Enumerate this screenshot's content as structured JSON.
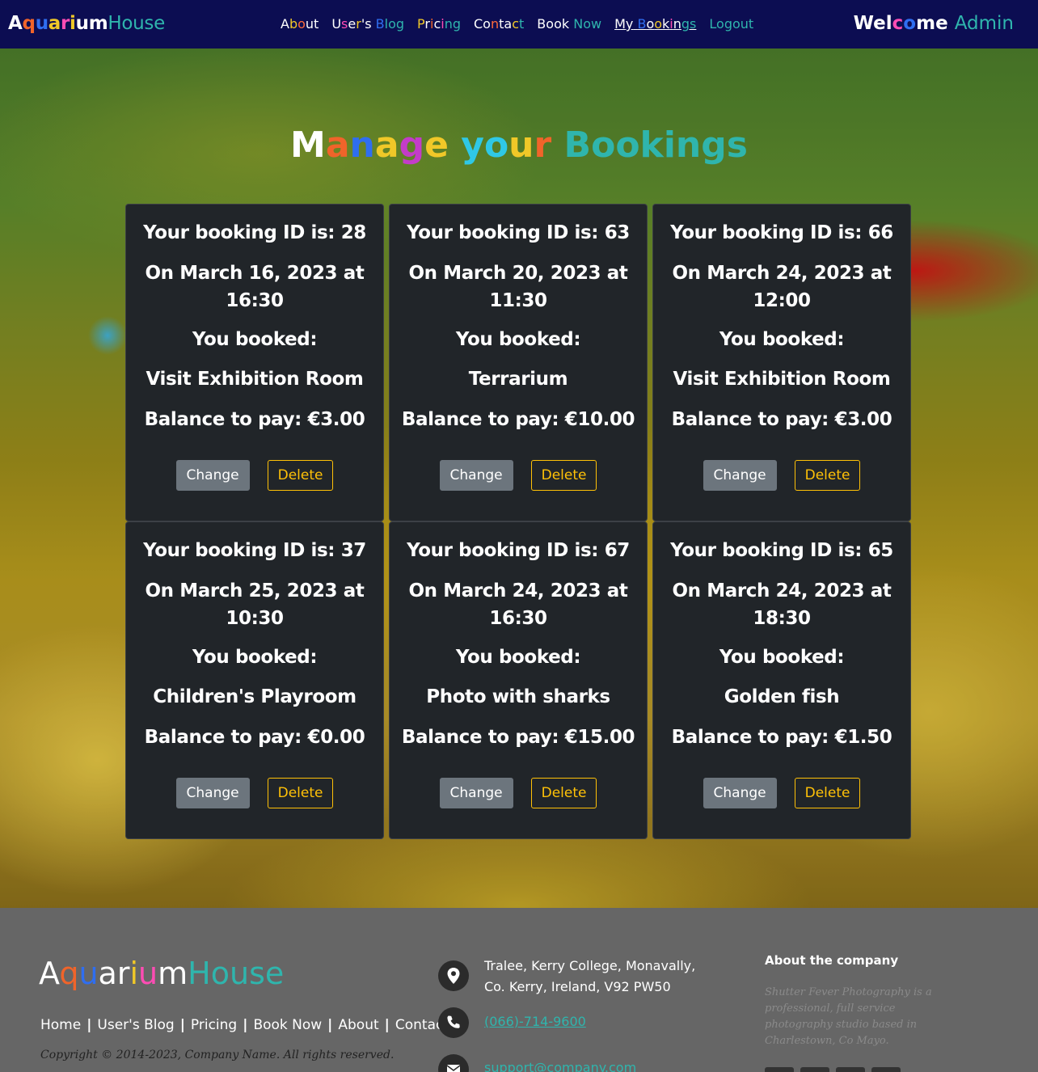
{
  "navbar": {
    "brand": {
      "letters": [
        {
          "ch": "A",
          "color": "#ffffff"
        },
        {
          "ch": "q",
          "color": "#f0642a"
        },
        {
          "ch": "u",
          "color": "#2f6ef0"
        },
        {
          "ch": "a",
          "color": "#f0c828"
        },
        {
          "ch": "r",
          "color": "#ff4cb4"
        },
        {
          "ch": "i",
          "color": "#f0c828"
        },
        {
          "ch": "u",
          "color": "#ffffff"
        },
        {
          "ch": "m",
          "color": "#ffffff"
        }
      ],
      "suffix": "House"
    },
    "links": [
      {
        "label": "About",
        "colors": [
          "#ffffff",
          "#f0c828",
          "#ff6a3a",
          "#ffffff",
          "#ffffff"
        ]
      },
      {
        "label": "User's Blog",
        "colors": [
          "#ffffff",
          "#ff4cb4",
          "#ffffff",
          "#f0c828",
          "#ffffff",
          "#ffffff",
          "#ffffff",
          "#2f6ef0",
          "#2fb5ad",
          "#2fb5ad",
          "#2fb5ad"
        ]
      },
      {
        "label": "Pricing",
        "colors": [
          "#f0c828",
          "#ffffff",
          "#f0642a",
          "#ffffff",
          "#ff4cb4",
          "#2fb5ad",
          "#2fb5ad"
        ]
      },
      {
        "label": "Contact",
        "colors": [
          "#ffffff",
          "#ffffff",
          "#ff6a3a",
          "#ffffff",
          "#ffffff",
          "#f0c828",
          "#2fb5ad"
        ]
      },
      {
        "label": "Book Now",
        "colors": [
          "#ffffff",
          "#ffffff",
          "#ffffff",
          "#ffffff",
          "#ffffff",
          "#2fb5ad",
          "#2fb5ad",
          "#2fb5ad"
        ]
      },
      {
        "label": "My Bookings",
        "colors": [
          "#ffffff",
          "#ffffff",
          "#ffffff",
          "#2f6ef0",
          "#ffffff",
          "#f0c828",
          "#ffffff",
          "#ff4cb4",
          "#ffffff",
          "#2fb5ad",
          "#2fb5ad"
        ],
        "active": true
      },
      {
        "label": "Logout",
        "colors": [
          "#2fb5ad",
          "#2fb5ad",
          "#2fb5ad",
          "#2fb5ad",
          "#2fb5ad",
          "#2fb5ad"
        ]
      }
    ],
    "welcome": {
      "letters": [
        {
          "ch": "W",
          "color": "#ffffff"
        },
        {
          "ch": "e",
          "color": "#ffffff"
        },
        {
          "ch": "l",
          "color": "#ffffff"
        },
        {
          "ch": "c",
          "color": "#ff4cb4"
        },
        {
          "ch": "o",
          "color": "#2f6ef0"
        },
        {
          "ch": "m",
          "color": "#ffffff"
        },
        {
          "ch": "e",
          "color": "#ffffff"
        }
      ],
      "name": "Admin"
    }
  },
  "page_title": {
    "letters": [
      {
        "ch": "M",
        "color": "#ffffff"
      },
      {
        "ch": "a",
        "color": "#f0642a"
      },
      {
        "ch": "n",
        "color": "#2f6ef0"
      },
      {
        "ch": "a",
        "color": "#f0c828"
      },
      {
        "ch": "g",
        "color": "#c33cc8"
      },
      {
        "ch": "e",
        "color": "#f0c828"
      },
      {
        "ch": " ",
        "color": "#ffffff"
      },
      {
        "ch": "y",
        "color": "#2fc8e6"
      },
      {
        "ch": "o",
        "color": "#2fc8e6"
      },
      {
        "ch": "u",
        "color": "#f0c828"
      },
      {
        "ch": "r",
        "color": "#f0642a"
      },
      {
        "ch": " ",
        "color": "#ffffff"
      },
      {
        "ch": "B",
        "color": "#2fb5ad"
      },
      {
        "ch": "o",
        "color": "#2fb5ad"
      },
      {
        "ch": "o",
        "color": "#2fb5ad"
      },
      {
        "ch": "k",
        "color": "#2fb5ad"
      },
      {
        "ch": "i",
        "color": "#2fb5ad"
      },
      {
        "ch": "n",
        "color": "#2fb5ad"
      },
      {
        "ch": "g",
        "color": "#2fb5ad"
      },
      {
        "ch": "s",
        "color": "#2fb5ad"
      }
    ]
  },
  "bookings": [
    {
      "id_line": "Your booking ID is: 28",
      "date_line": "On March 16, 2023 at",
      "time_line": "16:30",
      "booked_label": "You booked:",
      "item": "Visit Exhibition Room",
      "balance": "Balance to pay: €3.00",
      "change_label": "Change",
      "delete_label": "Delete"
    },
    {
      "id_line": "Your booking ID is: 63",
      "date_line": "On March 20, 2023 at",
      "time_line": "11:30",
      "booked_label": "You booked:",
      "item": "Terrarium",
      "balance": "Balance to pay: €10.00",
      "change_label": "Change",
      "delete_label": "Delete"
    },
    {
      "id_line": "Your booking ID is: 66",
      "date_line": "On March 24, 2023 at",
      "time_line": "12:00",
      "booked_label": "You booked:",
      "item": "Visit Exhibition Room",
      "balance": "Balance to pay: €3.00",
      "change_label": "Change",
      "delete_label": "Delete"
    },
    {
      "id_line": "Your booking ID is: 37",
      "date_line": "On March 25, 2023 at",
      "time_line": "10:30",
      "booked_label": "You booked:",
      "item": "Children's Playroom",
      "balance": "Balance to pay: €0.00",
      "change_label": "Change",
      "delete_label": "Delete"
    },
    {
      "id_line": "Your booking ID is: 67",
      "date_line": "On March 24, 2023 at",
      "time_line": "16:30",
      "booked_label": "You booked:",
      "item": "Photo with sharks",
      "balance": "Balance to pay: €15.00",
      "change_label": "Change",
      "delete_label": "Delete"
    },
    {
      "id_line": "Your booking ID is: 65",
      "date_line": "On March 24, 2023 at",
      "time_line": "18:30",
      "booked_label": "You booked:",
      "item": "Golden fish",
      "balance": "Balance to pay: €1.50",
      "change_label": "Change",
      "delete_label": "Delete"
    }
  ],
  "footer": {
    "brand": {
      "letters": [
        {
          "ch": "A",
          "color": "#ffffff"
        },
        {
          "ch": "q",
          "color": "#f0642a"
        },
        {
          "ch": "u",
          "color": "#2f6ef0"
        },
        {
          "ch": "a",
          "color": "#ffffff"
        },
        {
          "ch": "r",
          "color": "#ffffff"
        },
        {
          "ch": "i",
          "color": "#f0c828"
        },
        {
          "ch": "u",
          "color": "#ff4cb4"
        },
        {
          "ch": "m",
          "color": "#ffffff"
        }
      ],
      "suffix": "House"
    },
    "links": [
      "Home",
      "User's Blog",
      "Pricing",
      "Book Now",
      "About",
      "Contact"
    ],
    "copyright": "Copyright © 2014-2023, Company Name. All rights reserved.",
    "address_line1": "Tralee, Kerry College, Monavally,",
    "address_line2": "Co. Kerry, Ireland, V92 PW50",
    "phone": "(066)-714-9600",
    "email": "support@company.com",
    "about_heading": "About the company",
    "about_text": "Shutter Fever Photography is a professional, full service photography studio based in Charlestown, Co Mayo.",
    "icons": [
      "map-pin-icon",
      "phone-icon",
      "envelope-icon"
    ]
  },
  "colors": {
    "navbar_bg": "#0c0d52",
    "card_bg": "#212529",
    "accent_teal": "#2fb5ad",
    "delete_yellow": "#ffc107",
    "change_gray": "#6c757d",
    "footer_bg": "#666666"
  }
}
